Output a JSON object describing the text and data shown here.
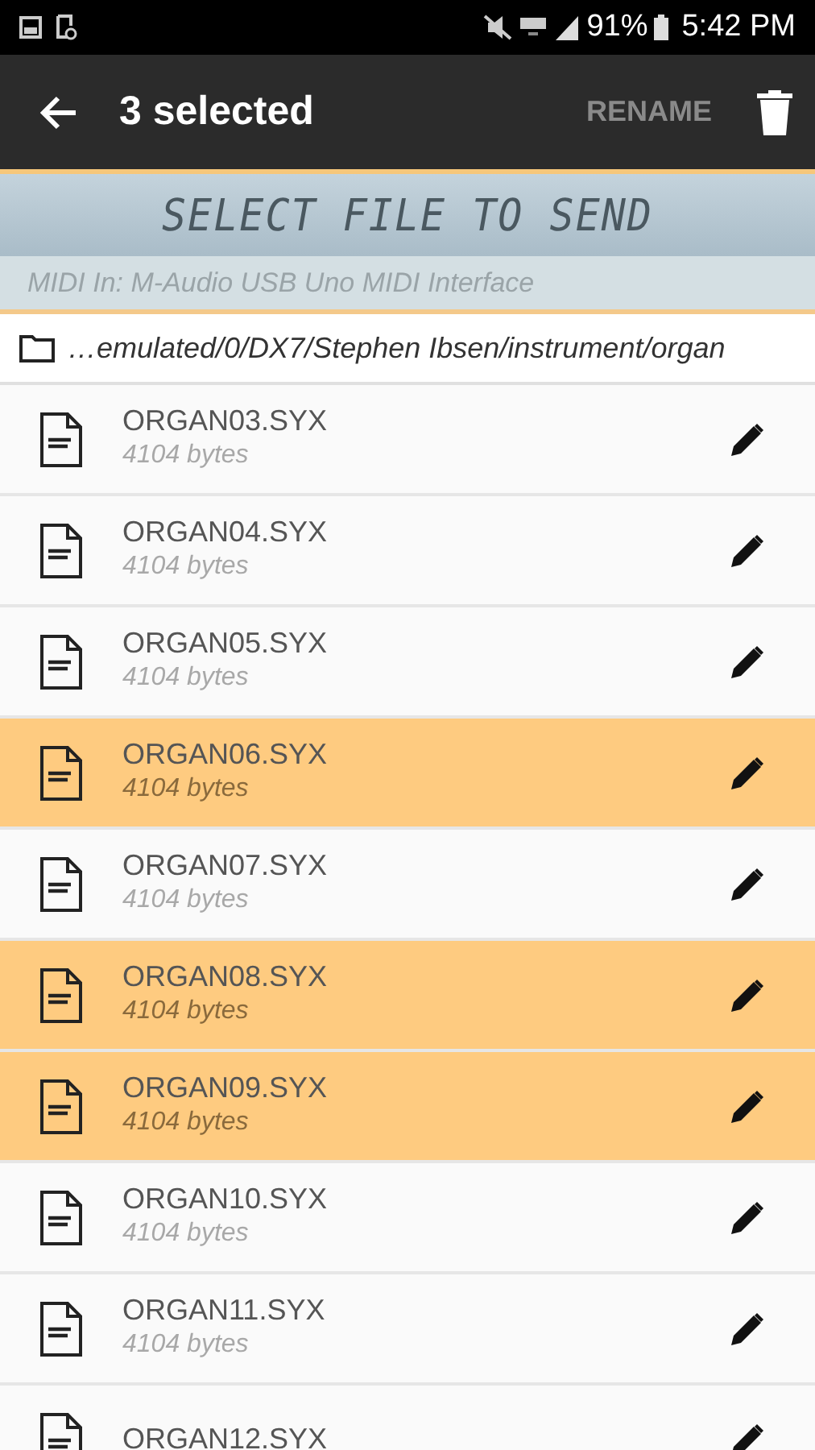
{
  "status_bar": {
    "battery": "91%",
    "time": "5:42 PM"
  },
  "app_bar": {
    "title": "3 selected",
    "action": "RENAME"
  },
  "header": {
    "title": "SELECT FILE TO SEND",
    "midi_in": "MIDI In: M-Audio USB Uno MIDI Interface"
  },
  "path": "…emulated/0/DX7/Stephen Ibsen/instrument/organ",
  "files": [
    {
      "name": "ORGAN03.SYX",
      "size": "4104 bytes",
      "selected": false
    },
    {
      "name": "ORGAN04.SYX",
      "size": "4104 bytes",
      "selected": false
    },
    {
      "name": "ORGAN05.SYX",
      "size": "4104 bytes",
      "selected": false
    },
    {
      "name": "ORGAN06.SYX",
      "size": "4104 bytes",
      "selected": true
    },
    {
      "name": "ORGAN07.SYX",
      "size": "4104 bytes",
      "selected": false
    },
    {
      "name": "ORGAN08.SYX",
      "size": "4104 bytes",
      "selected": true
    },
    {
      "name": "ORGAN09.SYX",
      "size": "4104 bytes",
      "selected": true
    },
    {
      "name": "ORGAN10.SYX",
      "size": "4104 bytes",
      "selected": false
    },
    {
      "name": "ORGAN11.SYX",
      "size": "4104 bytes",
      "selected": false
    },
    {
      "name": "ORGAN12.SYX",
      "selected": false
    }
  ]
}
